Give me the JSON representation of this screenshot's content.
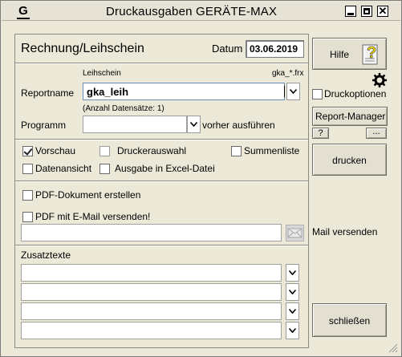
{
  "window": {
    "app_icon": "G",
    "title": "Druckausgaben  GERÄTE-MAX"
  },
  "header": {
    "heading": "Rechnung/Leihschein",
    "date_label": "Datum",
    "date_value": "03.06.2019"
  },
  "report": {
    "top_left_label": "Leihschein",
    "top_right_label": "gka_*.frx",
    "reportname_label": "Reportname",
    "reportname_value": "gka_leih",
    "record_count": "(Anzahl Datensätze: 1)",
    "programm_label": "Programm",
    "programm_value": "",
    "programm_suffix": "vorher ausführen"
  },
  "options": {
    "vorschau": {
      "label": "Vorschau",
      "checked": true
    },
    "druckerauswahl": {
      "label": "Druckerauswahl",
      "checked": false
    },
    "summenliste": {
      "label": "Summenliste",
      "checked": false
    },
    "datenansicht": {
      "label": "Datenansicht",
      "checked": false
    },
    "excel": {
      "label": "Ausgabe in Excel-Datei",
      "checked": false
    }
  },
  "pdf": {
    "create": {
      "label": "PDF-Dokument erstellen",
      "checked": false
    },
    "email": {
      "label": "PDF mit E-Mail versenden!",
      "checked": false
    },
    "email_value": "",
    "mail_send_label": "Mail versenden"
  },
  "zusatz": {
    "label": "Zusatztexte",
    "fields": [
      "",
      "",
      "",
      ""
    ]
  },
  "sidebar": {
    "help_label": "Hilfe",
    "druckoptionen_label": "Druckoptionen",
    "report_manager_label": "Report-Manager",
    "question_label": "?",
    "ellipsis_label": "...",
    "print_label": "drucken",
    "close_label": "schließen"
  },
  "icons": {
    "help": "help-question-icon",
    "gear": "gear-icon",
    "mail": "mail-envelope-icon",
    "dropdown": "chevron-down-icon"
  }
}
